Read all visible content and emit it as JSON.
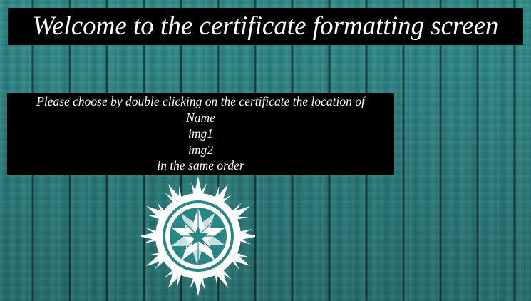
{
  "header": {
    "title": "Welcome to the certificate formatting screen"
  },
  "instructions": {
    "lines": [
      "Please choose by double clicking on the certificate the location of",
      "Name",
      "img1",
      "img2",
      "in the same order"
    ]
  },
  "certificate": {
    "icon": "sun-emblem-icon",
    "color": "#ffffff"
  },
  "colors": {
    "background": "#2a8585",
    "panel": "#000000",
    "text": "#ffffff"
  }
}
